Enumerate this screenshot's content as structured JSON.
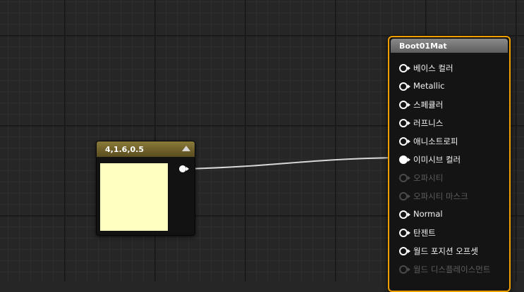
{
  "constant_node": {
    "title": "4,1.6,0.5",
    "swatch_color": "#ffffbf"
  },
  "material_node": {
    "title": "Boot01Mat",
    "border_color": "#f0a000",
    "pins": [
      {
        "label": "베이스 컬러",
        "state": "enabled"
      },
      {
        "label": "Metallic",
        "state": "enabled"
      },
      {
        "label": "스페큘러",
        "state": "enabled"
      },
      {
        "label": "러프니스",
        "state": "enabled"
      },
      {
        "label": "애니소트로피",
        "state": "enabled"
      },
      {
        "label": "이미시브 컬러",
        "state": "connected"
      },
      {
        "label": "오파시티",
        "state": "disabled"
      },
      {
        "label": "오파시티 마스크",
        "state": "disabled"
      },
      {
        "label": "Normal",
        "state": "enabled"
      },
      {
        "label": "탄젠트",
        "state": "enabled"
      },
      {
        "label": "월드 포지션 오프셋",
        "state": "enabled"
      },
      {
        "label": "월드 디스플레이스먼트",
        "state": "disabled"
      }
    ]
  }
}
